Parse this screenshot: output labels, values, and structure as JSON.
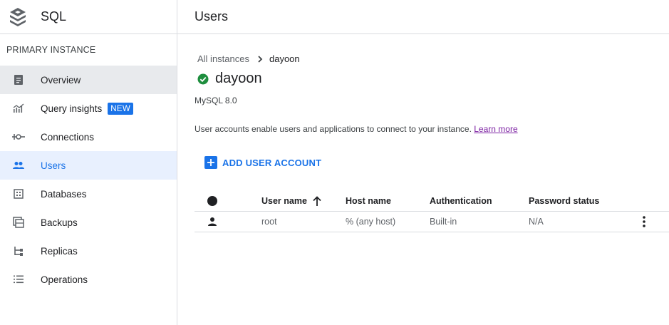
{
  "app": {
    "title": "SQL"
  },
  "sidebar": {
    "section": "PRIMARY INSTANCE",
    "items": [
      {
        "label": "Overview"
      },
      {
        "label": "Query insights",
        "badge": "NEW"
      },
      {
        "label": "Connections"
      },
      {
        "label": "Users"
      },
      {
        "label": "Databases"
      },
      {
        "label": "Backups"
      },
      {
        "label": "Replicas"
      },
      {
        "label": "Operations"
      }
    ]
  },
  "header": {
    "title": "Users"
  },
  "breadcrumb": {
    "parent": "All instances",
    "current": "dayoon"
  },
  "instance": {
    "name": "dayoon",
    "version": "MySQL 8.0",
    "status_color": "#1e8e3e"
  },
  "description": {
    "text": "User accounts enable users and applications to connect to your instance.",
    "link": "Learn more"
  },
  "actions": {
    "add_user": "ADD USER ACCOUNT"
  },
  "table": {
    "columns": [
      "User name",
      "Host name",
      "Authentication",
      "Password status"
    ],
    "rows": [
      {
        "user": "root",
        "host": "% (any host)",
        "auth": "Built-in",
        "password": "N/A"
      }
    ]
  },
  "colors": {
    "accent": "#1a73e8",
    "active_bg": "#e8f0fe",
    "link_visited": "#7b1fa2"
  }
}
